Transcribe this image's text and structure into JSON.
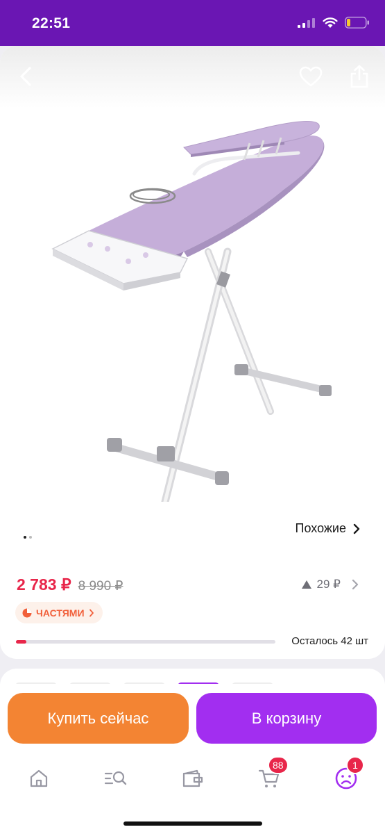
{
  "status": {
    "time": "22:51",
    "icons": [
      "signal-icon",
      "wifi-icon",
      "battery-icon"
    ]
  },
  "product": {
    "similar_label": "Похожие",
    "price": "2 783 ₽",
    "old_price": "8 990 ₽",
    "bonus": "29 ₽",
    "installments_label": "ЧАСТЯМИ",
    "stock_label": "Осталось 42 шт",
    "stock_level": 0.04,
    "image_count": 2,
    "active_image": 1
  },
  "actions": {
    "buy_now": "Купить сейчас",
    "add_to_cart": "В корзину"
  },
  "tabbar": {
    "cart_badge": "88",
    "profile_badge": "1"
  },
  "colors": {
    "brand": "#6a16b3",
    "price": "#e8264a",
    "buy_button": "#f38433",
    "cart_button": "#a22ef0"
  }
}
